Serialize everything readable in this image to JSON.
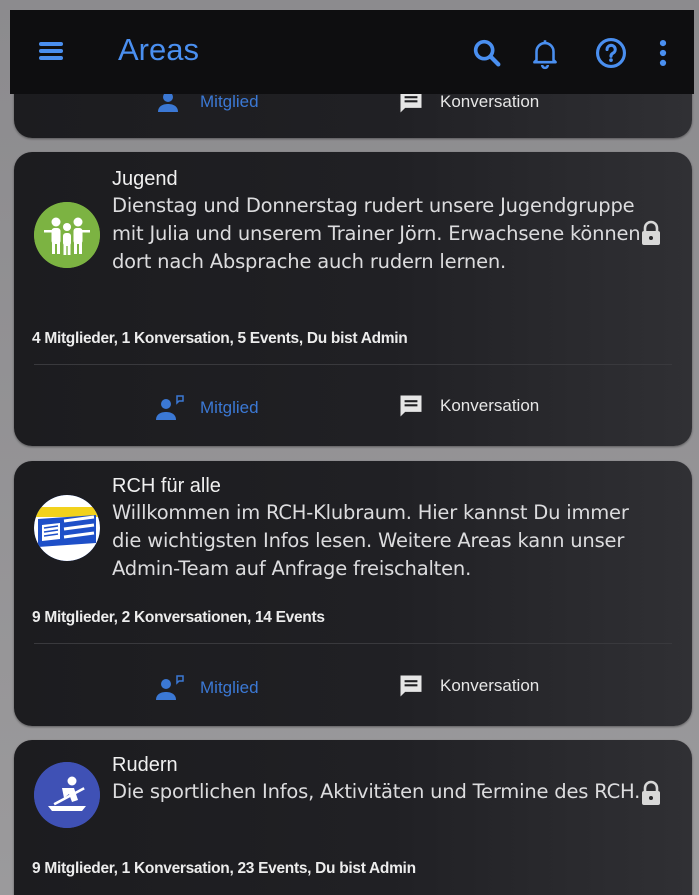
{
  "appbar": {
    "title": "Areas",
    "icons": [
      "menu-icon",
      "search-icon",
      "bell-icon",
      "help-icon",
      "more-vert-icon"
    ],
    "accent": "#4a8ff0"
  },
  "partial_card": {
    "member_label": "Mitglied",
    "conversation_label": "Konversation"
  },
  "areas": [
    {
      "title": "Jugend",
      "description": "Dienstag und Donnerstag rudert unsere Jugendgruppe mit Julia und unserem Trainer Jörn. Erwachsene können dort nach Absprache auch rudern lernen.",
      "stats": "4 Mitglieder, 1 Konversation, 5 Events, Du bist Admin",
      "member_label": "Mitglied",
      "conversation_label": "Konversation",
      "locked": true,
      "avatar_icon": "group-people-icon",
      "avatar_color": "#7cb342"
    },
    {
      "title": "RCH für alle",
      "description": "Willkommen im RCH-Klubraum. Hier kannst Du immer die wichtigsten Infos lesen. Weitere Areas kann unser Admin-Team auf Anfrage freischalten.",
      "stats": "9 Mitglieder, 2 Konversationen, 14 Events",
      "member_label": "Mitglied",
      "conversation_label": "Konversation",
      "locked": false,
      "avatar_icon": "club-flag-icon",
      "avatar_color": "#1e4fc8"
    },
    {
      "title": "Rudern",
      "description": "Die sportlichen Infos, Aktivitäten und Termine des RCH.",
      "stats": "9 Mitglieder, 1 Konversation, 23 Events, Du bist Admin",
      "locked": true,
      "avatar_icon": "rowing-icon",
      "avatar_color": "#3f51b5"
    }
  ]
}
